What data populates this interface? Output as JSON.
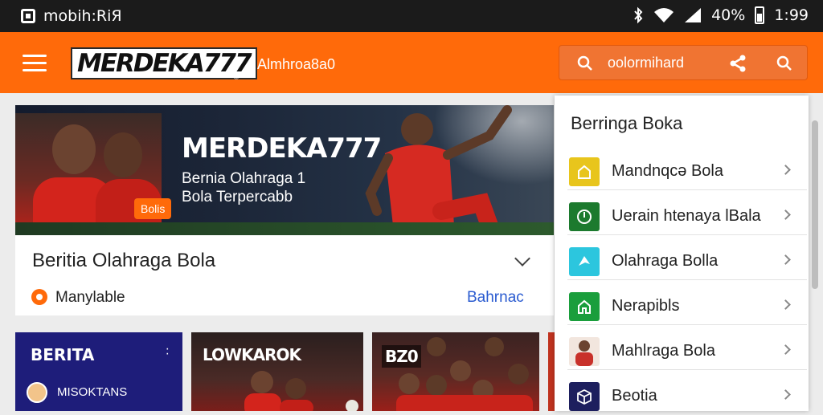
{
  "status_bar": {
    "app_label": "mobih:RiЯ",
    "battery": "40%",
    "time": "1:99"
  },
  "app_bar": {
    "logo": "MERDEKA777",
    "subtitle": "Almhroa8a0",
    "search_text": "oolormihard"
  },
  "hero": {
    "title": "MERDEKA777",
    "subtitle_line1": "Bernia Olahraga 1",
    "subtitle_line2": "Bola  Terpercabb",
    "badge": "Bolis"
  },
  "article_card": {
    "title": "Beritia Olahraga Bola",
    "author": "Manylable",
    "link": "Bahrnac"
  },
  "tiles": [
    {
      "label": "BERITA",
      "user": "MISOKTANS"
    },
    {
      "label": "LOWKAROK"
    },
    {
      "label": "BZ0"
    }
  ],
  "side_panel": {
    "title": "Berringa Boka",
    "items": [
      {
        "label": "Mandnqcə Bola",
        "icon": "house-outline-icon",
        "color": "#e8c51c"
      },
      {
        "label": "Uerain htenaya lBala",
        "icon": "power-icon",
        "color": "#1c7a2e"
      },
      {
        "label": "Olahraga Bolla",
        "icon": "ball-icon",
        "color": "#2cc6de"
      },
      {
        "label": "Nerapibls",
        "icon": "house-icon",
        "color": "#1a9e3c"
      },
      {
        "label": "Mahlraga Bola",
        "icon": "player-thumbnail-icon",
        "color": "#c8312a"
      },
      {
        "label": "Beotia",
        "icon": "box-icon",
        "color": "#1d1f5e"
      }
    ]
  },
  "colors": {
    "accent": "#ff6a0a",
    "status_bar": "#1b1b1b",
    "link": "#2a5bd0"
  }
}
